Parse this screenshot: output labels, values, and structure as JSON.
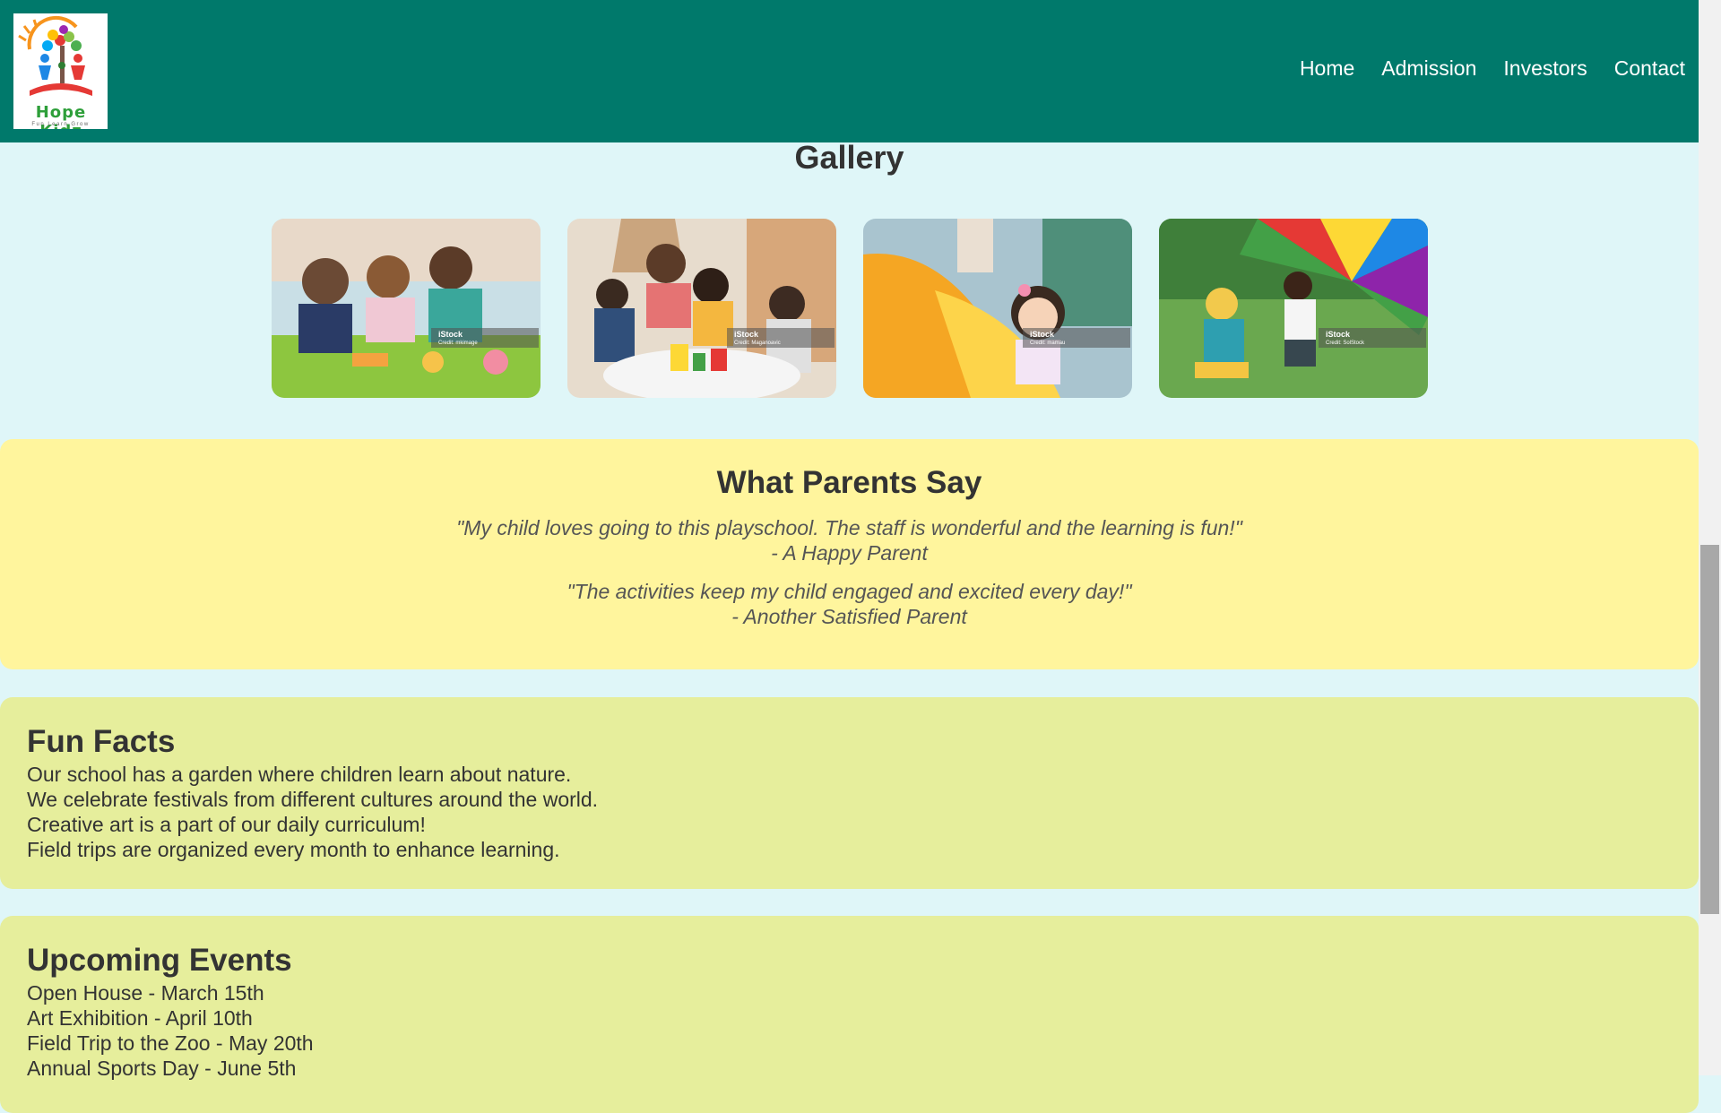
{
  "header": {
    "logo": {
      "name": "Hope Kidz",
      "tagline": "Fun Learn Grow"
    },
    "nav": [
      "Home",
      "Admission",
      "Investors",
      "Contact"
    ]
  },
  "gallery": {
    "title": "Gallery",
    "images": [
      {
        "badge": "iStock",
        "credit": "Credit: mkimage"
      },
      {
        "badge": "iStock",
        "credit": "Credit: Maganoavic"
      },
      {
        "badge": "iStock",
        "credit": "Credit: mamau"
      },
      {
        "badge": "iStock",
        "credit": "Credit: SolStock"
      }
    ]
  },
  "testimonials": {
    "title": "What Parents Say",
    "items": [
      {
        "quote": "\"My child loves going to this playschool. The staff is wonderful and the learning is fun!\"",
        "author": "- A Happy Parent"
      },
      {
        "quote": "\"The activities keep my child engaged and excited every day!\"",
        "author": "- Another Satisfied Parent"
      }
    ]
  },
  "fun_facts": {
    "title": "Fun Facts",
    "items": [
      "Our school has a garden where children learn about nature.",
      "We celebrate festivals from different cultures around the world.",
      "Creative art is a part of our daily curriculum!",
      "Field trips are organized every month to enhance learning."
    ]
  },
  "events": {
    "title": "Upcoming Events",
    "items": [
      "Open House - March 15th",
      "Art Exhibition - April 10th",
      "Field Trip to the Zoo - May 20th",
      "Annual Sports Day - June 5th"
    ]
  }
}
